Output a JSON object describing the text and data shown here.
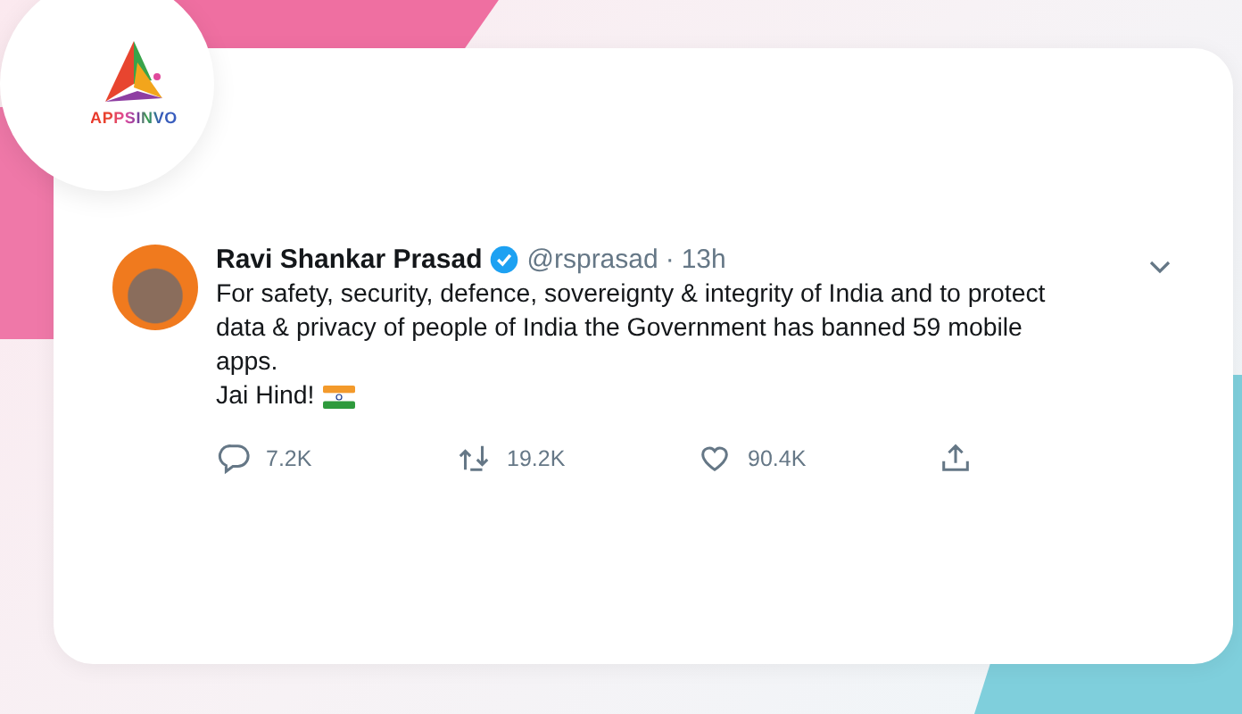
{
  "logo": {
    "text": "APPSINVO"
  },
  "tweet": {
    "name": "Ravi Shankar Prasad",
    "verified": true,
    "handle": "@rsprasad",
    "separator": "·",
    "time": "13h",
    "text": "For safety, security, defence, sovereignty & integrity of India and to protect data & privacy of people of India the Government has banned 59 mobile apps.",
    "closing": "Jai Hind!",
    "actions": [
      {
        "kind": "reply",
        "count": "7.2K"
      },
      {
        "kind": "retweet",
        "count": "19.2K"
      },
      {
        "kind": "like",
        "count": "90.4K"
      },
      {
        "kind": "share"
      }
    ]
  }
}
